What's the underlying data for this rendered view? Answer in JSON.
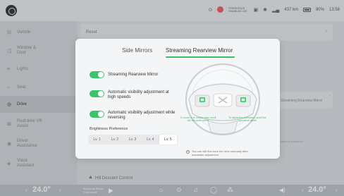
{
  "statusbar": {
    "fr_label": "FREEDRIVE",
    "fr_sublabel": "ENABLED ON",
    "range": "437 km",
    "battery": "90%",
    "time": "13:58"
  },
  "sidebar": {
    "items": [
      {
        "label": "Vehicle",
        "icon": "car-icon"
      },
      {
        "label": "Window & Door",
        "icon": "window-icon"
      },
      {
        "label": "Lights",
        "icon": "light-icon"
      },
      {
        "label": "Seat",
        "icon": "seat-icon"
      },
      {
        "label": "Drive",
        "icon": "steering-icon"
      },
      {
        "label": "Real-time VR Assist",
        "icon": "vr-icon"
      },
      {
        "label": "Driver Assistance",
        "icon": "assist-icon"
      },
      {
        "label": "Voice Assistant",
        "icon": "voice-icon"
      }
    ]
  },
  "main": {
    "reset_label": "Reset",
    "right_card": "Streaming Rearview Mirror",
    "right_note": "Button is enabled if",
    "hill_label": "Hill Descent Control"
  },
  "dock": {
    "temp_left": "24.0°",
    "temp_right": "24.0°",
    "media_line1": "Bluetooth Music",
    "media_line2": "Connected"
  },
  "modal": {
    "tabs": [
      "Side Mirrors",
      "Streaming Rearview Mirror"
    ],
    "toggles": [
      {
        "label": "Streaming Rearview Mirror",
        "on": true
      },
      {
        "label": "Automatic visibility adjustment at high speeds",
        "on": true
      },
      {
        "label": "Automatic visibility adjustment while reversing",
        "on": true
      }
    ],
    "brightness_label": "Brightness Preference",
    "brightness_levels": [
      "Lv. 1",
      "Lv. 2",
      "Lv. 3",
      "Lv. 4",
      "Lv. 5"
    ],
    "brightness_selected": "Lv. 5",
    "button_note_left": "To zoom in or out the view, scroll the left scroll wheel",
    "button_note_right": "To adjust the orientation, scroll the right scroll wheel",
    "manual_note": "You can still fine-tune the view manually after automatic adjustment"
  },
  "colors": {
    "accent": "#3cc36c"
  }
}
